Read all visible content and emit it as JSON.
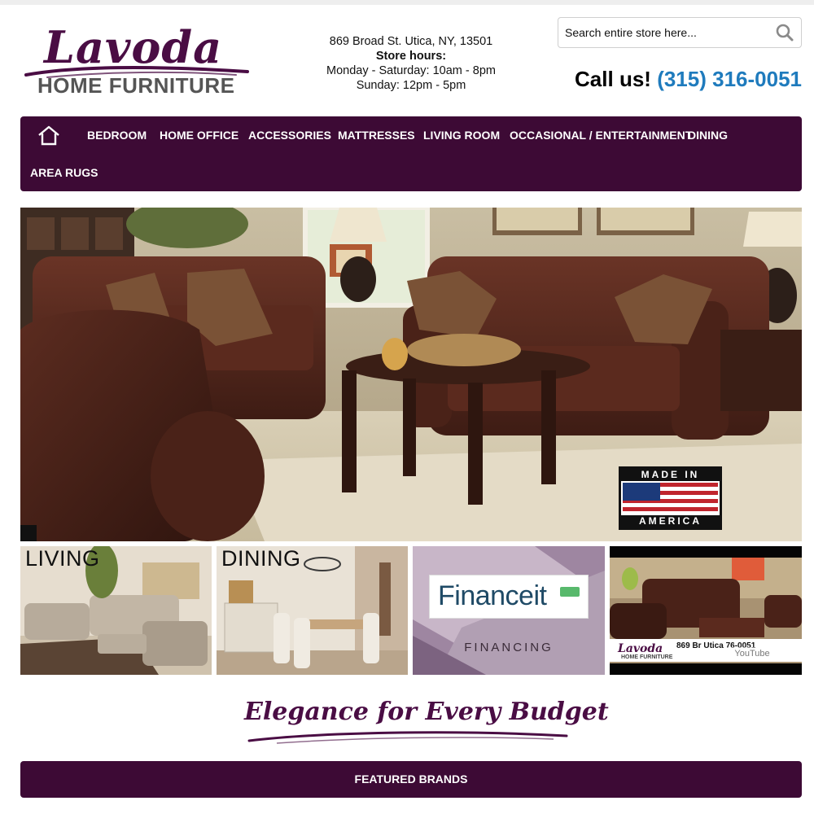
{
  "header": {
    "logo_script": "Lavoda",
    "logo_subtitle": "HOME FURNITURE",
    "address": "869 Broad St. Utica, NY, 13501",
    "hours_title": "Store hours:",
    "hours_weekday": "Monday - Saturday: 10am - 8pm",
    "hours_sunday": "Sunday: 12pm - 5pm",
    "search_placeholder": "Search entire store here...",
    "call_lead": "Call us!",
    "phone": "(315) 316-0051"
  },
  "nav": {
    "items": [
      "BEDROOM",
      "HOME OFFICE",
      "ACCESSORIES",
      "MATTRESSES",
      "LIVING ROOM",
      "OCCASIONAL / ENTERTAINMENT",
      "DINING",
      "AREA RUGS"
    ]
  },
  "hero": {
    "badge_top": "MADE IN",
    "badge_bottom": "AMERICA"
  },
  "tiles": {
    "living": "LIVING",
    "dining": "DINING",
    "finance_logo": "Financeit",
    "finance_sub": "FINANCING",
    "video_logo": "Lavoda",
    "video_logo_sub": "HOME FURNITURE",
    "video_address": "869 Br      Utica   76-0051",
    "video_mark": "YouTube"
  },
  "tagline": "Elegance for Every Budget",
  "featured_label": "FEATURED BRANDS",
  "colors": {
    "brand_purple": "#3d0a35",
    "logo_purple": "#4a0d44",
    "phone_blue": "#1f7bbd"
  },
  "icons": [
    "home-icon",
    "search-icon",
    "play-icon"
  ]
}
